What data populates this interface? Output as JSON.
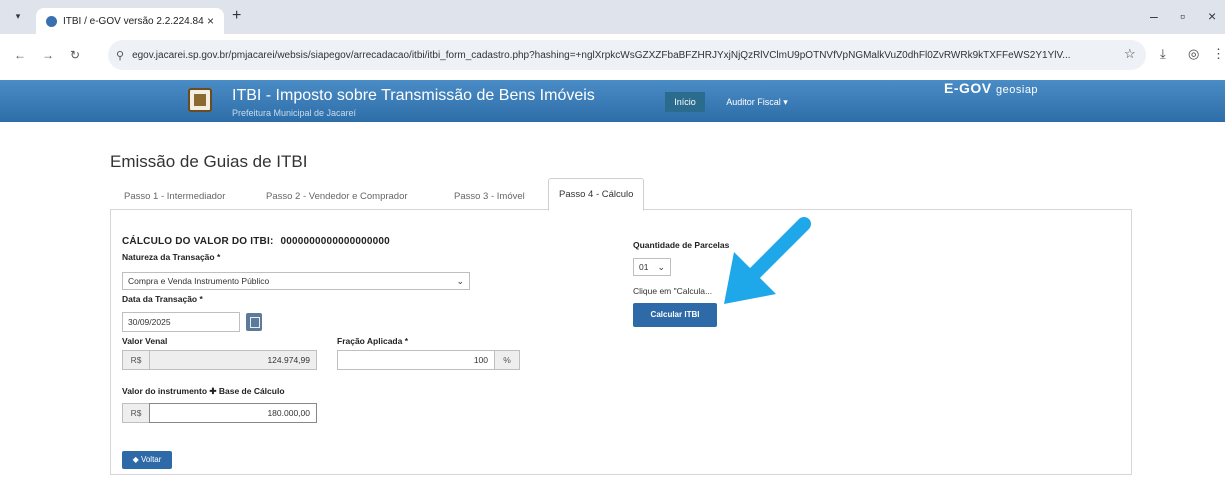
{
  "browser": {
    "tab_title": "ITBI / e-GOV versão 2.2.224.84",
    "tab_close": "×",
    "new_tab": "+",
    "url": "egov.jacarei.sp.gov.br/pmjacarei/websis/siapegov/arrecadacao/itbi/itbi_form_cadastro.php?hashing=+nglXrpkcWsGZXZFbaBFZHRJYxjNjQzRlVClmU9pOTNVfVpNGMalkVuZ0dhFl0ZvRWRk9kTXFFeWS2Y1YlV..."
  },
  "app": {
    "title": "ITBI - Imposto sobre Transmissão de Bens Imóveis",
    "subtitle": "Prefeitura Municipal de Jacareí",
    "nav_home": "Início",
    "nav_user": "Auditor Fiscal ▾",
    "brand": "E-GOV",
    "brand2": "geosiap"
  },
  "page": {
    "title": "Emissão de Guias de ITBI",
    "tabs": [
      {
        "label": "Passo 1 - Intermediador"
      },
      {
        "label": "Passo 2 - Vendedor e Comprador"
      },
      {
        "label": "Passo 3 - Imóvel"
      },
      {
        "label": "Passo 4 - Cálculo"
      }
    ],
    "active_tab_index": 3
  },
  "form": {
    "heading": "CÁLCULO DO VALOR DO ITBI:",
    "heading_value": "0000000000000000000",
    "natureza_label": "Natureza da Transação *",
    "natureza_value": "Compra e Venda Instrumento Público",
    "data_label": "Data da Transação *",
    "data_value": "30/09/2025",
    "venal_label": "Valor Venal",
    "venal_prefix": "R$",
    "venal_value": "124.974,99",
    "fracao_label": "Fração Aplicada *",
    "fracao_value": "100",
    "fracao_suffix": "%",
    "instrumento_label": "Valor do instrumento ✚ Base de Cálculo",
    "instrumento_prefix": "R$",
    "instrumento_value": "180.000,00",
    "parcelas_label": "Quantidade de Parcelas",
    "parcelas_value": "01",
    "hint": "Clique em \"Calcula...",
    "calc_button": "Calcular ITBI",
    "back_button": "◆ Voltar"
  },
  "colors": {
    "header": "#2e6ea8",
    "button": "#2f6aa8",
    "arrow": "#1ea8ea"
  }
}
